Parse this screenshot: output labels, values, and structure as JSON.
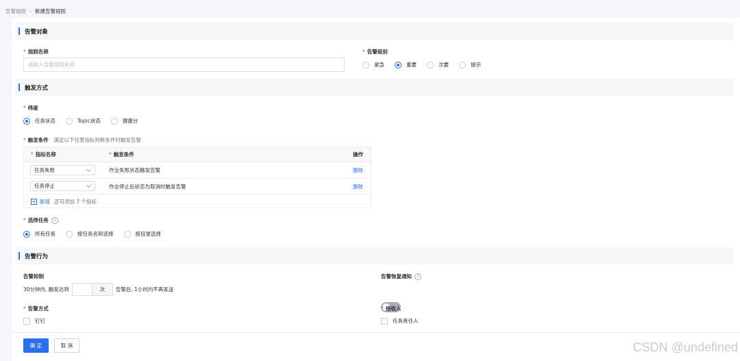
{
  "breadcrumb": {
    "parent": "告警规则",
    "current": "新建告警规则"
  },
  "sections": {
    "target": "告警对象",
    "trigger": "触发方式",
    "behavior": "告警行为"
  },
  "rule_name": {
    "label": "规则名称",
    "placeholder": "请输入告警规则名称"
  },
  "alert_level": {
    "label": "告警级别",
    "options": [
      "紧急",
      "重要",
      "次要",
      "提示"
    ],
    "selected": "重要"
  },
  "dimension": {
    "label": "纬度",
    "options": [
      "任务状态",
      "Topic状态",
      "健康分"
    ],
    "selected": "任务状态"
  },
  "trigger_condition": {
    "label": "触发条件",
    "hint": "满足以下任意指标判断条件时触发告警",
    "columns": [
      "指标名称",
      "触发条件",
      "操作"
    ],
    "rows": [
      {
        "metric": "任务失败",
        "condition": "作业失败状态触发告警",
        "action": "删除"
      },
      {
        "metric": "任务停止",
        "condition": "作业停止后状态为取消时触发告警",
        "action": "删除"
      }
    ],
    "add_label": "新增",
    "remaining_prefix": "还可添加",
    "remaining_count": "7",
    "remaining_suffix": "个指标"
  },
  "select_task": {
    "label": "选择任务",
    "options": [
      "所有任务",
      "按任务名称选择",
      "按目录选择"
    ],
    "selected": "所有任务"
  },
  "suppress": {
    "label": "告警抑制",
    "prefix": "30分钟内, 触发达到",
    "unit": "次",
    "suffix": "告警后, 1小时内不再发送"
  },
  "recovery": {
    "label": "告警恢复通知",
    "enabled": false
  },
  "alert_method": {
    "label": "告警方式",
    "options": [
      "钉钉"
    ]
  },
  "receiver": {
    "label": "接收人",
    "options": [
      "任务责任人"
    ]
  },
  "footer": {
    "confirm": "确 定",
    "cancel": "取 消"
  },
  "watermark": "CSDN @undefined",
  "colors": {
    "primary": "#2a6fef",
    "required": "#e84848"
  }
}
